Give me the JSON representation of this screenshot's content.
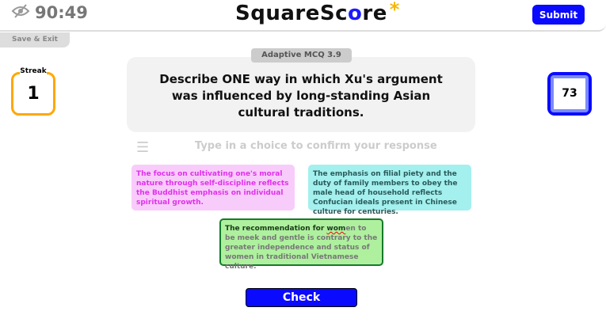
{
  "header": {
    "timer": "90:49",
    "logo_main": "SquareSc",
    "logo_o": "o",
    "logo_end": "re",
    "logo_star": "*",
    "submit": "Submit"
  },
  "save_exit": "Save & Exit",
  "streak": {
    "label": "Streak",
    "value": "1"
  },
  "score": "73",
  "question": {
    "tag": "Adaptive MCQ 3.9",
    "text": "Describe ONE way in which Xu's argument was influenced by long-standing Asian cultural traditions."
  },
  "input_placeholder": "Type in a choice to confirm your response",
  "choices": [
    {
      "text": "The focus on cultivating one's moral nature through self-discipline reflects the Buddhist emphasis on individual spiritual growth."
    },
    {
      "text": "The emphasis on filial piety and the duty of family members to obey the male head of household reflects Confucian ideals present in Chinese culture for centuries."
    },
    {
      "typed_a": "The recommendation for ",
      "typed_b": "wom",
      "rest": "en to be meek and gentle is contrary to the greater independence and status of women in traditional Vietnamese culture."
    }
  ],
  "check": "Check",
  "colors": {
    "accent": "#0a0aff",
    "streak": "#ffa800"
  }
}
